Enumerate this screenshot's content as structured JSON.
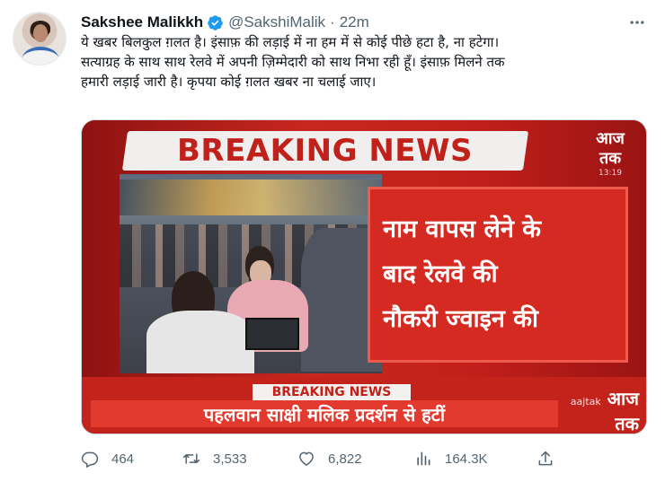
{
  "tweet": {
    "author_name": "Sakshee Malikkh",
    "handle": "@SakshiMalik",
    "separator": "·",
    "time": "22m",
    "text_lines": [
      "ये खबर बिलकुल ग़लत है। इंसाफ़ की लड़ाई में ना हम में से कोई पीछे हटा है, ना हटेगा।",
      "सत्याग्रह के साथ साथ रेलवे में अपनी ज़िम्मेदारी को साथ निभा रही हूँ। इंसाफ़ मिलने तक",
      "हमारी लड़ाई जारी है। कृपया कोई ग़लत खबर ना चलाई जाए।"
    ]
  },
  "media": {
    "banner_text": "BREAKING NEWS",
    "logo_text": "आज तक",
    "logo_sub": "13:19",
    "red_box_lines": [
      "नाम वापस लेने के",
      "बाद रेलवे की",
      "नौकरी ज्वाइन की"
    ],
    "bottom_label": "BREAKING NEWS",
    "bottom_headline": "पहलवान साक्षी मलिक प्रदर्शन से हटीं",
    "bottom_logo": "आज तक",
    "bottom_logo_prefix": "aajtak"
  },
  "actions": {
    "reply_count": "464",
    "retweet_count": "3,533",
    "like_count": "6,822",
    "views_count": "164.3K"
  },
  "colors": {
    "verified": "#1d9bf0",
    "icon": "#536471",
    "news_red": "#c8261f"
  },
  "icons": {
    "verified": "verified-badge-icon",
    "more": "more-icon",
    "reply": "reply-icon",
    "retweet": "retweet-icon",
    "like": "heart-icon",
    "views": "views-icon",
    "share": "share-icon"
  }
}
